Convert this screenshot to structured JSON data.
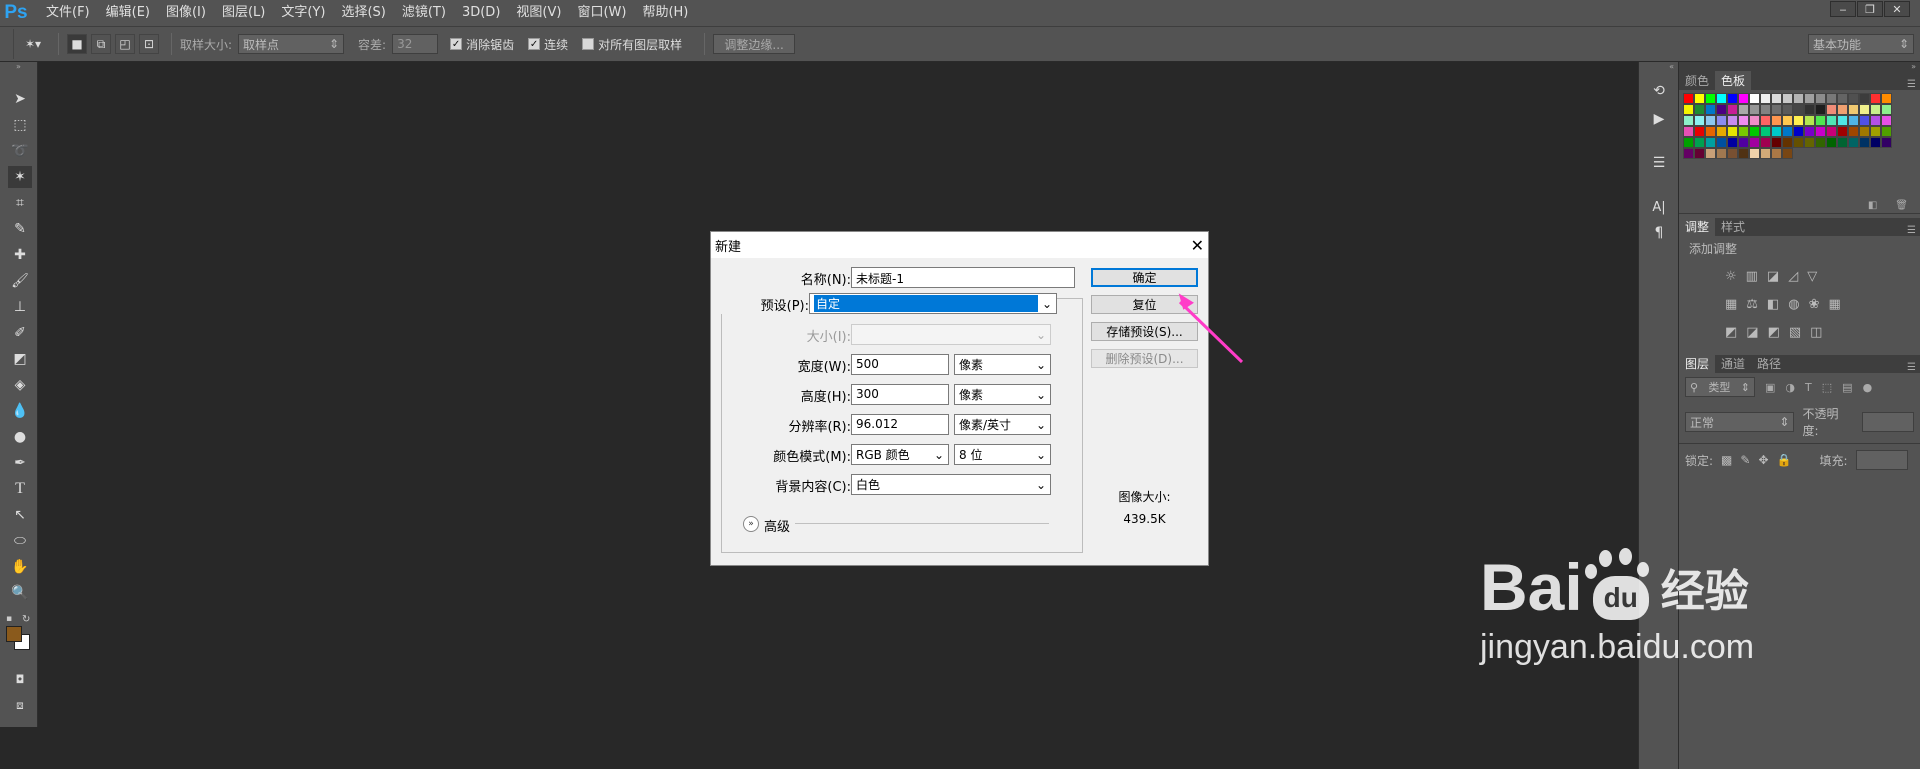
{
  "app": {
    "logo": "Ps"
  },
  "menu": [
    "文件(F)",
    "编辑(E)",
    "图像(I)",
    "图层(L)",
    "文字(Y)",
    "选择(S)",
    "滤镜(T)",
    "3D(D)",
    "视图(V)",
    "窗口(W)",
    "帮助(H)"
  ],
  "window_controls": {
    "minimize": "‒",
    "restore": "❐",
    "close": "✕"
  },
  "options": {
    "sample_size_label": "取样大小:",
    "sample_size_value": "取样点",
    "tolerance_label": "容差:",
    "tolerance_value": "32",
    "antialias_label": "消除锯齿",
    "contiguous_label": "连续",
    "all_layers_label": "对所有图层取样",
    "refine_edge_label": "调整边缘...",
    "workspace_value": "基本功能"
  },
  "panels": {
    "color_tabs": [
      "颜色",
      "色板"
    ],
    "adjust_tabs": [
      "调整",
      "样式"
    ],
    "adjust_title": "添加调整",
    "layers_tabs": [
      "图层",
      "通道",
      "路径"
    ],
    "layer_filter": "类型",
    "blend_mode": "正常",
    "opacity_label": "不透明度:",
    "lock_label": "锁定:",
    "fill_label": "填充:",
    "swatch_colors": [
      "#ff0000",
      "#ffff00",
      "#00ff00",
      "#00ffff",
      "#0000ff",
      "#ff00ff",
      "#ffffff",
      "#f0f0f0",
      "#dcdcdc",
      "#c8c8c8",
      "#b4b4b4",
      "#a0a0a0",
      "#8c8c8c",
      "#787878",
      "#646464",
      "#505050",
      "#3c3c3c",
      "#ff3030",
      "#ff8c00",
      "#f5f500",
      "#1e8c32",
      "#0078c8",
      "#4b0082",
      "#c81e96",
      "#aaaaaa",
      "#969696",
      "#828282",
      "#6e6e6e",
      "#5a5a5a",
      "#464646",
      "#323232",
      "#1e1e1e",
      "#f08c78",
      "#f0a070",
      "#f0c870",
      "#f0f08c",
      "#c8f08c",
      "#8cf08c",
      "#8cf0c8",
      "#8cf0f0",
      "#8cc8f0",
      "#8c8cf0",
      "#c88cf0",
      "#f08cf0",
      "#f08cc8",
      "#ff6464",
      "#ff9650",
      "#ffc850",
      "#fff050",
      "#b4e650",
      "#50e650",
      "#50e6b4",
      "#50e6e6",
      "#50b4e6",
      "#5050e6",
      "#b450e6",
      "#e650e6",
      "#e650b4",
      "#e60000",
      "#e66400",
      "#e6aa00",
      "#e6e600",
      "#78c800",
      "#00c800",
      "#00c878",
      "#00c8c8",
      "#0078c8",
      "#0000c8",
      "#7800c8",
      "#c800c8",
      "#c80078",
      "#a00000",
      "#a04600",
      "#a07800",
      "#a0a000",
      "#50a000",
      "#00a000",
      "#00a050",
      "#00a0a0",
      "#0050a0",
      "#0000a0",
      "#5000a0",
      "#a000a0",
      "#a00050",
      "#640000",
      "#643200",
      "#645000",
      "#646400",
      "#326400",
      "#006400",
      "#006432",
      "#006464",
      "#003264",
      "#000064",
      "#320064",
      "#640064",
      "#640032",
      "#c8a078",
      "#a07850",
      "#785032",
      "#503214",
      "#f0d2aa",
      "#d2aa78",
      "#aa7846",
      "#784614"
    ]
  },
  "dialog": {
    "title": "新建",
    "name_label": "名称(N):",
    "name_value": "未标题-1",
    "preset_label": "预设(P):",
    "preset_value": "自定",
    "size_label": "大小(I):",
    "width_label": "宽度(W):",
    "width_value": "500",
    "width_unit": "像素",
    "height_label": "高度(H):",
    "height_value": "300",
    "height_unit": "像素",
    "resolution_label": "分辨率(R):",
    "resolution_value": "96.012",
    "resolution_unit": "像素/英寸",
    "color_mode_label": "颜色模式(M):",
    "color_mode_value": "RGB 颜色",
    "bit_depth_value": "8 位",
    "background_label": "背景内容(C):",
    "background_value": "白色",
    "advanced_label": "高级",
    "ok_label": "确定",
    "reset_label": "复位",
    "save_preset_label": "存储预设(S)...",
    "delete_preset_label": "删除预设(D)...",
    "image_size_label": "图像大小:",
    "image_size_value": "439.5K"
  },
  "watermark": {
    "brand": "Bai",
    "brand2": "du",
    "product": "经验",
    "url": "jingyan.baidu.com"
  }
}
